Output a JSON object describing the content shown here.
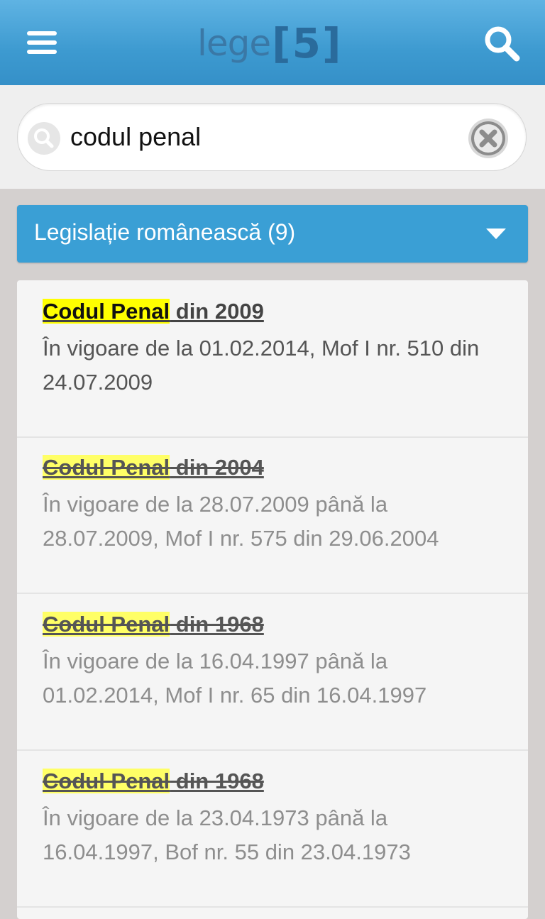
{
  "header": {
    "logo_word": "lege",
    "logo_number": "[5]"
  },
  "search": {
    "query": "codul penal"
  },
  "category": {
    "label": "Legislație românească (9)"
  },
  "results": [
    {
      "title_highlight": "Codul Penal",
      "title_rest": " din 2009",
      "description": "În vigoare de la 01.02.2014, Mof I nr. 510 din 24.07.2009",
      "repealed": false
    },
    {
      "title_highlight": "Codul Penal",
      "title_rest": " din 2004",
      "description": "În vigoare de la 28.07.2009 până la 28.07.2009, Mof I nr. 575 din 29.06.2004",
      "repealed": true
    },
    {
      "title_highlight": "Codul Penal",
      "title_rest": " din 1968",
      "description": "În vigoare de la 16.04.1997 până la 01.02.2014, Mof I nr. 65 din 16.04.1997",
      "repealed": true
    },
    {
      "title_highlight": "Codul Penal",
      "title_rest": " din 1968",
      "description": "În vigoare de la 23.04.1973 până la 16.04.1997, Bof nr. 55 din 23.04.1973",
      "repealed": true
    }
  ],
  "icons": {
    "menu": "hamburger-icon",
    "search": "search-icon",
    "clear": "clear-icon",
    "dropdown": "chevron-down-icon"
  },
  "colors": {
    "header": "#3d9ad0",
    "category": "#3a9fd5",
    "highlight": "#ffff00"
  }
}
